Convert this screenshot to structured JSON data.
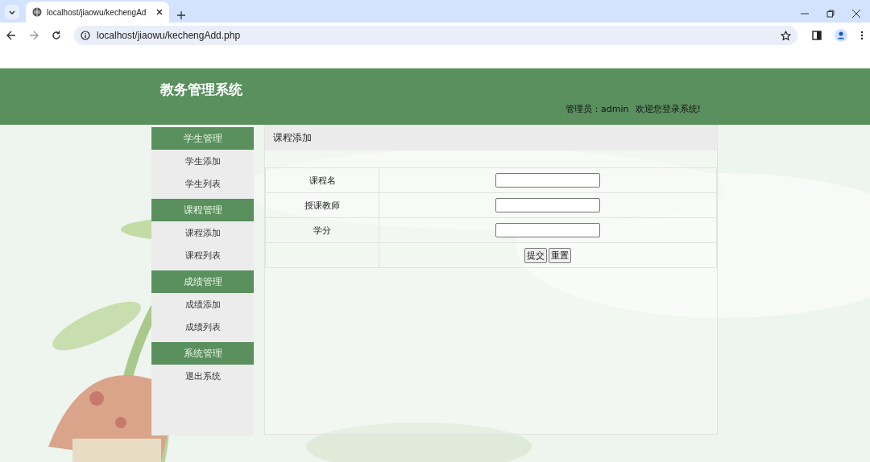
{
  "browser": {
    "tab_title": "localhost/jiaowu/kechengAd",
    "url": "localhost/jiaowu/kechengAdd.php"
  },
  "header": {
    "title": "教务管理系统",
    "user_label": "管理员：admin",
    "welcome": "欢迎您登录系统!"
  },
  "sidebar": {
    "groups": [
      {
        "title": "学生管理",
        "items": [
          {
            "label": "学生添加"
          },
          {
            "label": "学生列表"
          }
        ]
      },
      {
        "title": "课程管理",
        "items": [
          {
            "label": "课程添加"
          },
          {
            "label": "课程列表"
          }
        ]
      },
      {
        "title": "成绩管理",
        "items": [
          {
            "label": "成绩添加"
          },
          {
            "label": "成绩列表"
          }
        ]
      },
      {
        "title": "系统管理",
        "items": [
          {
            "label": "退出系统"
          }
        ]
      }
    ]
  },
  "panel": {
    "title": "课程添加",
    "fields": [
      {
        "label": "课程名"
      },
      {
        "label": "授课教师"
      },
      {
        "label": "学分"
      }
    ],
    "buttons": [
      "提交",
      "重置"
    ]
  }
}
